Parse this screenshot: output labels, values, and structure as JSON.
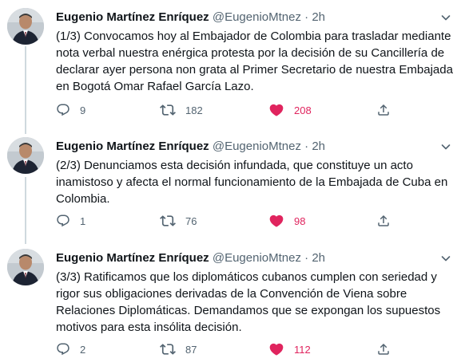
{
  "tweets": [
    {
      "name": "Eugenio Martínez Enríquez",
      "handle": "@EugenioMtnez",
      "separator": "·",
      "time": "2h",
      "text": "(1/3) Convocamos hoy al Embajador de Colombia para trasladar mediante nota verbal nuestra enérgica protesta por la decisión de su Cancillería de declarar ayer persona non grata al Primer Secretario de nuestra Embajada en Bogotá Omar Rafael García Lazo.",
      "replies": "9",
      "retweets": "182",
      "likes": "208"
    },
    {
      "name": "Eugenio Martínez Enríquez",
      "handle": "@EugenioMtnez",
      "separator": "·",
      "time": "2h",
      "text": "(2/3) Denunciamos esta decisión infundada, que constituye un acto inamistoso y afecta el normal funcionamiento de la Embajada de Cuba en Colombia.",
      "replies": "1",
      "retweets": "76",
      "likes": "98"
    },
    {
      "name": "Eugenio Martínez Enríquez",
      "handle": "@EugenioMtnez",
      "separator": "·",
      "time": "2h",
      "text": "(3/3) Ratificamos que los diplomáticos cubanos cumplen con seriedad y rigor sus obligaciones derivadas de la Convención de Viena sobre Relaciones Diplomáticas. Demandamos que se expongan los supuestos motivos para esta insólita decisión.",
      "replies": "2",
      "retweets": "87",
      "likes": "112"
    }
  ],
  "colors": {
    "like_active": "#e0245e",
    "muted": "#536471",
    "text": "#0f1419",
    "thread_line": "#cfd9de"
  },
  "icons": {
    "reply": "reply-icon",
    "retweet": "retweet-icon",
    "like": "heart-icon",
    "share": "share-icon",
    "more": "chevron-down-icon"
  }
}
